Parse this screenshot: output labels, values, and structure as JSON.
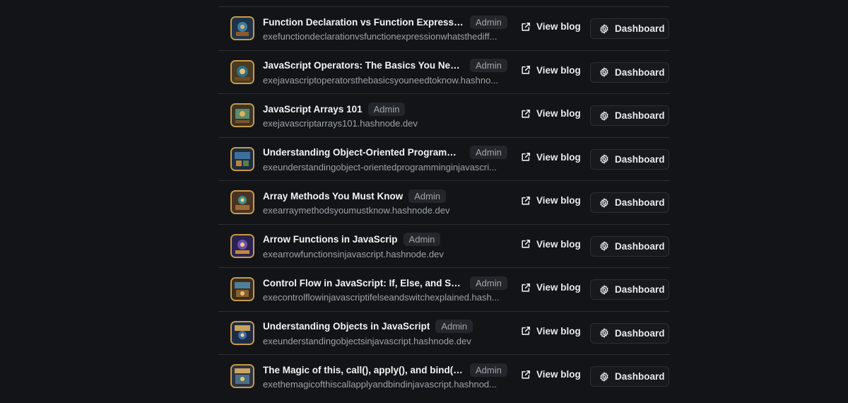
{
  "blogs": [
    {
      "title": "Function Declaration vs Function Expression:...",
      "role": "Admin",
      "domain": "exefunctiondeclarationvsfunctionexpressionwhatsthediff...",
      "view_label": "View blog",
      "dashboard_label": "Dashboard"
    },
    {
      "title": "JavaScript Operators: The Basics You Need t...",
      "role": "Admin",
      "domain": "exejavascriptoperatorsthebasicsyouneedtoknow.hashno...",
      "view_label": "View blog",
      "dashboard_label": "Dashboard"
    },
    {
      "title": "JavaScript Arrays 101",
      "role": "Admin",
      "domain": "exejavascriptarrays101.hashnode.dev",
      "view_label": "View blog",
      "dashboard_label": "Dashboard"
    },
    {
      "title": "Understanding Object-Oriented Programmi...",
      "role": "Admin",
      "domain": "exeunderstandingobject-orientedprogramminginjavascri...",
      "view_label": "View blog",
      "dashboard_label": "Dashboard"
    },
    {
      "title": "Array Methods You Must Know",
      "role": "Admin",
      "domain": "exearraymethodsyoumustknow.hashnode.dev",
      "view_label": "View blog",
      "dashboard_label": "Dashboard"
    },
    {
      "title": "Arrow Functions in JavaScrip",
      "role": "Admin",
      "domain": "exearrowfunctionsinjavascript.hashnode.dev",
      "view_label": "View blog",
      "dashboard_label": "Dashboard"
    },
    {
      "title": "Control Flow in JavaScript: If, Else, and Switc...",
      "role": "Admin",
      "domain": "execontrolflowinjavascriptifelseandswitchexplained.hash...",
      "view_label": "View blog",
      "dashboard_label": "Dashboard"
    },
    {
      "title": "Understanding Objects in JavaScript",
      "role": "Admin",
      "domain": "exeunderstandingobjectsinjavascript.hashnode.dev",
      "view_label": "View blog",
      "dashboard_label": "Dashboard"
    },
    {
      "title": "The Magic of this, call(), apply(), and bind() i...",
      "role": "Admin",
      "domain": "exethemagicofthiscallapplyandbindinjavascript.hashnod...",
      "view_label": "View blog",
      "dashboard_label": "Dashboard"
    }
  ],
  "icons": {
    "thumbnail": "blog-thumbnail-icon",
    "view": "external-link-icon",
    "dashboard": "gear-icon"
  },
  "colors": {
    "background": "#121417",
    "divider": "#2a2d31",
    "title_text": "#f2f3f5",
    "muted_text": "#9ea3aa",
    "badge_bg": "#23262a",
    "thumbnail_border": "#c79a4a"
  }
}
